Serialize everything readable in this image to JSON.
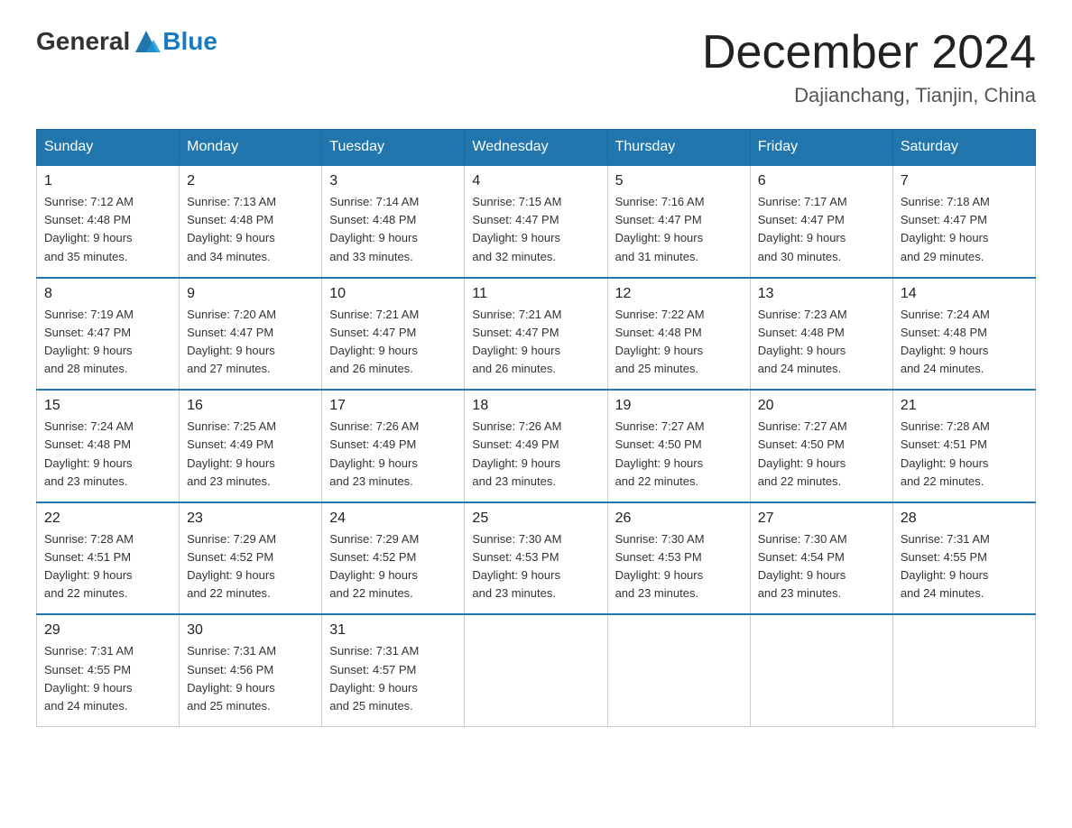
{
  "logo": {
    "general": "General",
    "blue": "Blue"
  },
  "header": {
    "month": "December 2024",
    "location": "Dajianchang, Tianjin, China"
  },
  "weekdays": [
    "Sunday",
    "Monday",
    "Tuesday",
    "Wednesday",
    "Thursday",
    "Friday",
    "Saturday"
  ],
  "weeks": [
    [
      {
        "day": "1",
        "sunrise": "7:12 AM",
        "sunset": "4:48 PM",
        "daylight": "9 hours and 35 minutes."
      },
      {
        "day": "2",
        "sunrise": "7:13 AM",
        "sunset": "4:48 PM",
        "daylight": "9 hours and 34 minutes."
      },
      {
        "day": "3",
        "sunrise": "7:14 AM",
        "sunset": "4:48 PM",
        "daylight": "9 hours and 33 minutes."
      },
      {
        "day": "4",
        "sunrise": "7:15 AM",
        "sunset": "4:47 PM",
        "daylight": "9 hours and 32 minutes."
      },
      {
        "day": "5",
        "sunrise": "7:16 AM",
        "sunset": "4:47 PM",
        "daylight": "9 hours and 31 minutes."
      },
      {
        "day": "6",
        "sunrise": "7:17 AM",
        "sunset": "4:47 PM",
        "daylight": "9 hours and 30 minutes."
      },
      {
        "day": "7",
        "sunrise": "7:18 AM",
        "sunset": "4:47 PM",
        "daylight": "9 hours and 29 minutes."
      }
    ],
    [
      {
        "day": "8",
        "sunrise": "7:19 AM",
        "sunset": "4:47 PM",
        "daylight": "9 hours and 28 minutes."
      },
      {
        "day": "9",
        "sunrise": "7:20 AM",
        "sunset": "4:47 PM",
        "daylight": "9 hours and 27 minutes."
      },
      {
        "day": "10",
        "sunrise": "7:21 AM",
        "sunset": "4:47 PM",
        "daylight": "9 hours and 26 minutes."
      },
      {
        "day": "11",
        "sunrise": "7:21 AM",
        "sunset": "4:47 PM",
        "daylight": "9 hours and 26 minutes."
      },
      {
        "day": "12",
        "sunrise": "7:22 AM",
        "sunset": "4:48 PM",
        "daylight": "9 hours and 25 minutes."
      },
      {
        "day": "13",
        "sunrise": "7:23 AM",
        "sunset": "4:48 PM",
        "daylight": "9 hours and 24 minutes."
      },
      {
        "day": "14",
        "sunrise": "7:24 AM",
        "sunset": "4:48 PM",
        "daylight": "9 hours and 24 minutes."
      }
    ],
    [
      {
        "day": "15",
        "sunrise": "7:24 AM",
        "sunset": "4:48 PM",
        "daylight": "9 hours and 23 minutes."
      },
      {
        "day": "16",
        "sunrise": "7:25 AM",
        "sunset": "4:49 PM",
        "daylight": "9 hours and 23 minutes."
      },
      {
        "day": "17",
        "sunrise": "7:26 AM",
        "sunset": "4:49 PM",
        "daylight": "9 hours and 23 minutes."
      },
      {
        "day": "18",
        "sunrise": "7:26 AM",
        "sunset": "4:49 PM",
        "daylight": "9 hours and 23 minutes."
      },
      {
        "day": "19",
        "sunrise": "7:27 AM",
        "sunset": "4:50 PM",
        "daylight": "9 hours and 22 minutes."
      },
      {
        "day": "20",
        "sunrise": "7:27 AM",
        "sunset": "4:50 PM",
        "daylight": "9 hours and 22 minutes."
      },
      {
        "day": "21",
        "sunrise": "7:28 AM",
        "sunset": "4:51 PM",
        "daylight": "9 hours and 22 minutes."
      }
    ],
    [
      {
        "day": "22",
        "sunrise": "7:28 AM",
        "sunset": "4:51 PM",
        "daylight": "9 hours and 22 minutes."
      },
      {
        "day": "23",
        "sunrise": "7:29 AM",
        "sunset": "4:52 PM",
        "daylight": "9 hours and 22 minutes."
      },
      {
        "day": "24",
        "sunrise": "7:29 AM",
        "sunset": "4:52 PM",
        "daylight": "9 hours and 22 minutes."
      },
      {
        "day": "25",
        "sunrise": "7:30 AM",
        "sunset": "4:53 PM",
        "daylight": "9 hours and 23 minutes."
      },
      {
        "day": "26",
        "sunrise": "7:30 AM",
        "sunset": "4:53 PM",
        "daylight": "9 hours and 23 minutes."
      },
      {
        "day": "27",
        "sunrise": "7:30 AM",
        "sunset": "4:54 PM",
        "daylight": "9 hours and 23 minutes."
      },
      {
        "day": "28",
        "sunrise": "7:31 AM",
        "sunset": "4:55 PM",
        "daylight": "9 hours and 24 minutes."
      }
    ],
    [
      {
        "day": "29",
        "sunrise": "7:31 AM",
        "sunset": "4:55 PM",
        "daylight": "9 hours and 24 minutes."
      },
      {
        "day": "30",
        "sunrise": "7:31 AM",
        "sunset": "4:56 PM",
        "daylight": "9 hours and 25 minutes."
      },
      {
        "day": "31",
        "sunrise": "7:31 AM",
        "sunset": "4:57 PM",
        "daylight": "9 hours and 25 minutes."
      },
      null,
      null,
      null,
      null
    ]
  ]
}
